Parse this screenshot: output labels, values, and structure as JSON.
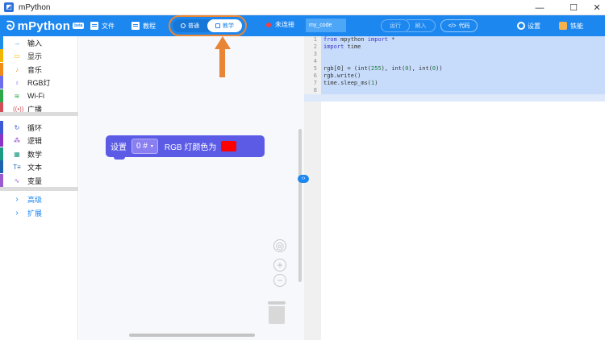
{
  "window": {
    "title": "mPython",
    "app_icon_glyph": "◩",
    "minimize_glyph": "—",
    "maximize_glyph": "☐",
    "close_glyph": "✕"
  },
  "toolbar": {
    "logo_text": "mPython",
    "logo_badge": "beta",
    "file_label": "文件",
    "tutorial_label": "教程",
    "mode_normal": "普通",
    "mode_teaching": "教学",
    "connection_status": "未连接",
    "filename": "my_code",
    "run_label": "运行",
    "flash_label": "刷入",
    "code_label": "代码",
    "settings_label": "设置",
    "user_label": "铁能"
  },
  "sidebar": {
    "categories": [
      {
        "label": "输入",
        "icon": "input-icon",
        "glyph": "→",
        "color": "#1e8ee8"
      },
      {
        "label": "显示",
        "icon": "display-icon",
        "glyph": "▭",
        "color": "#f2b600"
      },
      {
        "label": "音乐",
        "icon": "music-icon",
        "glyph": "♪",
        "color": "#f28a1a"
      },
      {
        "label": "RGB灯",
        "icon": "bulb-icon",
        "glyph": "♁",
        "color": "#6d6df0"
      },
      {
        "label": "Wi-Fi",
        "icon": "wifi-icon",
        "glyph": "≋",
        "color": "#2ca84a"
      },
      {
        "label": "广播",
        "icon": "broadcast-icon",
        "glyph": "((•))",
        "color": "#d54e57"
      },
      {
        "label": "循环",
        "icon": "loop-icon",
        "glyph": "↻",
        "color": "#3d5ad6"
      },
      {
        "label": "逻辑",
        "icon": "logic-icon",
        "glyph": "⁂",
        "color": "#8b35c8"
      },
      {
        "label": "数学",
        "icon": "math-icon",
        "glyph": "▦",
        "color": "#1e9a84"
      },
      {
        "label": "文本",
        "icon": "text-icon",
        "glyph": "T≡",
        "color": "#1d63b0"
      },
      {
        "label": "变量",
        "icon": "variable-icon",
        "glyph": "∿",
        "color": "#9c5ad0"
      }
    ],
    "advanced": [
      {
        "label": "高级",
        "glyph": "›"
      },
      {
        "label": "扩展",
        "glyph": "›"
      }
    ]
  },
  "block": {
    "prefix": "设置",
    "dropdown_value": "0 #",
    "dropdown_arrow": "▾",
    "suffix": "RGB 灯颜色为",
    "color": "#ff0000"
  },
  "workspace_controls": {
    "center_glyph": "◎",
    "zoom_in_glyph": "+",
    "zoom_out_glyph": "−",
    "split_glyph": "‹›"
  },
  "editor": {
    "lines": [
      {
        "n": "1",
        "segments": [
          {
            "t": "from",
            "c": "kw"
          },
          {
            "t": " mpython "
          },
          {
            "t": "import",
            "c": "kw"
          },
          {
            "t": " *"
          }
        ]
      },
      {
        "n": "2",
        "segments": [
          {
            "t": "import",
            "c": "kw"
          },
          {
            "t": " time"
          }
        ]
      },
      {
        "n": "3",
        "segments": []
      },
      {
        "n": "4",
        "segments": []
      },
      {
        "n": "5",
        "segments": [
          {
            "t": "rgb[0] = (int("
          },
          {
            "t": "255",
            "c": "num"
          },
          {
            "t": "), int("
          },
          {
            "t": "0",
            "c": "num"
          },
          {
            "t": "), int("
          },
          {
            "t": "0",
            "c": "num"
          },
          {
            "t": "))"
          }
        ]
      },
      {
        "n": "6",
        "segments": [
          {
            "t": "rgb.write()"
          }
        ]
      },
      {
        "n": "7",
        "segments": [
          {
            "t": "time.sleep_ms("
          },
          {
            "t": "1",
            "c": "num"
          },
          {
            "t": ")"
          }
        ]
      },
      {
        "n": "8",
        "segments": []
      }
    ]
  }
}
